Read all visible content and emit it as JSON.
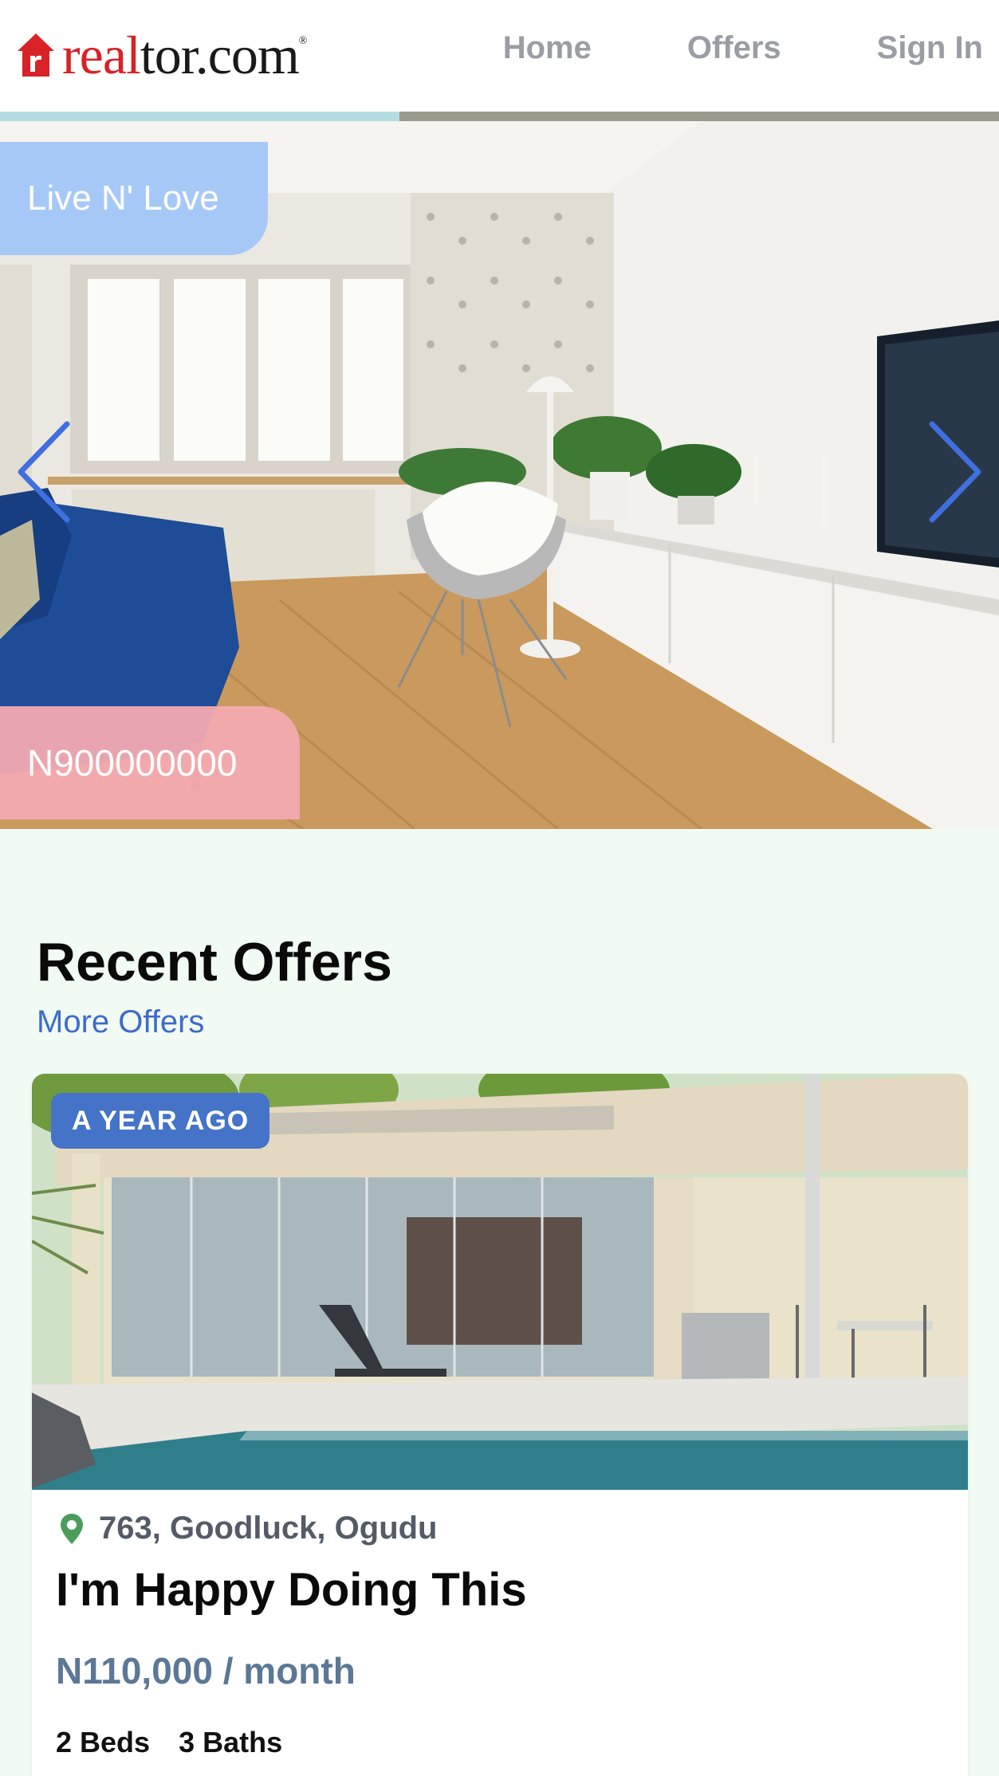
{
  "header": {
    "logo": {
      "text_part1": "real",
      "text_part2": "tor.com",
      "mark": "®"
    },
    "nav": [
      "Home",
      "Offers",
      "Sign In"
    ]
  },
  "slider": {
    "progress": 0.4,
    "tag": "Live N' Love",
    "price": "N900000000",
    "icons": {
      "prev": "chevron-left-icon",
      "next": "chevron-right-icon"
    },
    "arrow_color": "#3f6fe0"
  },
  "recent": {
    "title": "Recent Offers",
    "more_link": "More Offers"
  },
  "offer": {
    "badge": "A YEAR AGO",
    "location": "763, Goodluck, Ogudu",
    "title": "I'm Happy Doing This",
    "price": "N110,000 / month",
    "beds": "2 Beds",
    "baths": "3 Baths",
    "pin_color": "#4a9d5b"
  }
}
